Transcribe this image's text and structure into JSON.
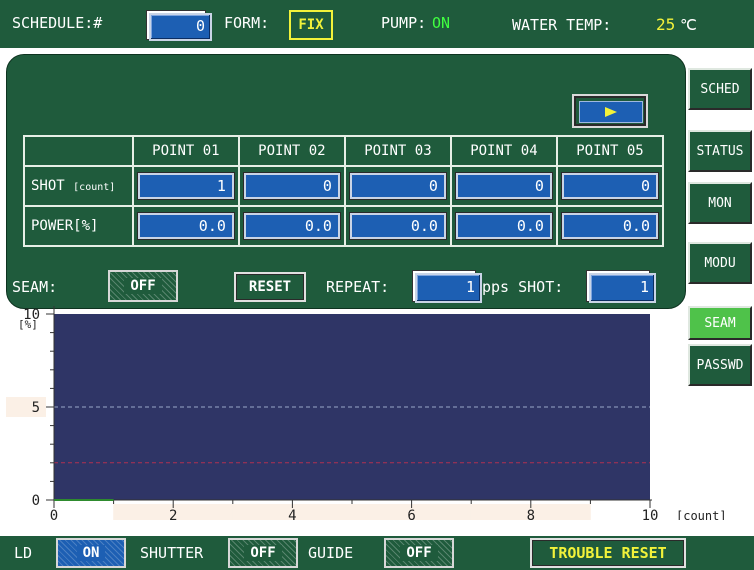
{
  "top_bar": {
    "schedule_label": "SCHEDULE:#",
    "schedule_value": "0",
    "form_label": "FORM:",
    "form_value": "FIX",
    "pump_label": "PUMP:",
    "pump_value": "ON",
    "water_temp_label": "WATER TEMP:",
    "water_temp_value": "25",
    "water_temp_unit": "℃"
  },
  "panel": {
    "play_icon": "play-icon",
    "columns": [
      "POINT 01",
      "POINT 02",
      "POINT 03",
      "POINT 04",
      "POINT 05"
    ],
    "rows": [
      {
        "label": "SHOT",
        "unit": "[count]",
        "values": [
          "1",
          "0",
          "0",
          "0",
          "0"
        ]
      },
      {
        "label": "POWER",
        "unit": "[%]",
        "values": [
          "0.0",
          "0.0",
          "0.0",
          "0.0",
          "0.0"
        ]
      }
    ],
    "seam_label": "SEAM:",
    "seam_value": "OFF",
    "reset_label": "RESET",
    "repeat_label": "REPEAT:",
    "repeat_value": "1",
    "pps_shot_label": "pps SHOT:",
    "pps_shot_value": "1"
  },
  "side_menu": [
    {
      "label": "SCHED",
      "active": false
    },
    {
      "label": "STATUS",
      "active": false
    },
    {
      "label": "MON",
      "active": false
    },
    {
      "label": "MODU",
      "active": false
    },
    {
      "label": "SEAM",
      "active": true
    },
    {
      "label": "PASSWD",
      "active": false
    }
  ],
  "chart_data": {
    "type": "line",
    "ylabel": "[%]",
    "xlabel": "[count]",
    "xlim": [
      0,
      10
    ],
    "ylim": [
      0,
      10
    ],
    "x_ticks": [
      "0",
      "2",
      "4",
      "6",
      "8",
      "10"
    ],
    "y_ticks": [
      "0",
      "5",
      "10"
    ],
    "reference_lines": [
      {
        "y": 5,
        "color": "#9aa6c8",
        "style": "dashed"
      },
      {
        "y": 2,
        "color": "#b03050",
        "style": "dashed"
      }
    ],
    "series": [
      {
        "x": [
          0,
          1
        ],
        "y": [
          0,
          0
        ],
        "color": "#2e8b2e"
      }
    ],
    "plot_bg": "#2f3566"
  },
  "bottom_bar": {
    "ld_label": "LD",
    "ld_value": "ON",
    "shutter_label": "SHUTTER",
    "shutter_value": "OFF",
    "guide_label": "GUIDE",
    "guide_value": "OFF",
    "trouble_reset_label": "TROUBLE RESET"
  }
}
